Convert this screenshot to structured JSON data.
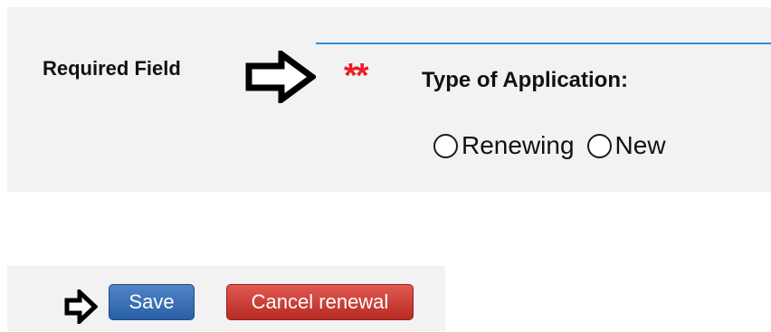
{
  "required_field_label": "Required Field",
  "required_marker": "**",
  "application": {
    "label": "Type of Application:",
    "options": [
      {
        "label": "Renewing",
        "selected": false
      },
      {
        "label": "New",
        "selected": false
      }
    ]
  },
  "actions": {
    "save_label": "Save",
    "cancel_label": "Cancel renewal"
  },
  "colors": {
    "accent_line": "#2c8fe3",
    "required_marker": "#ee1c24",
    "save_button": "#2f63a8",
    "cancel_button": "#c8332b"
  },
  "icons": {
    "pointer_large": "arrow-right-outline-icon",
    "pointer_small": "arrow-right-outline-icon"
  }
}
